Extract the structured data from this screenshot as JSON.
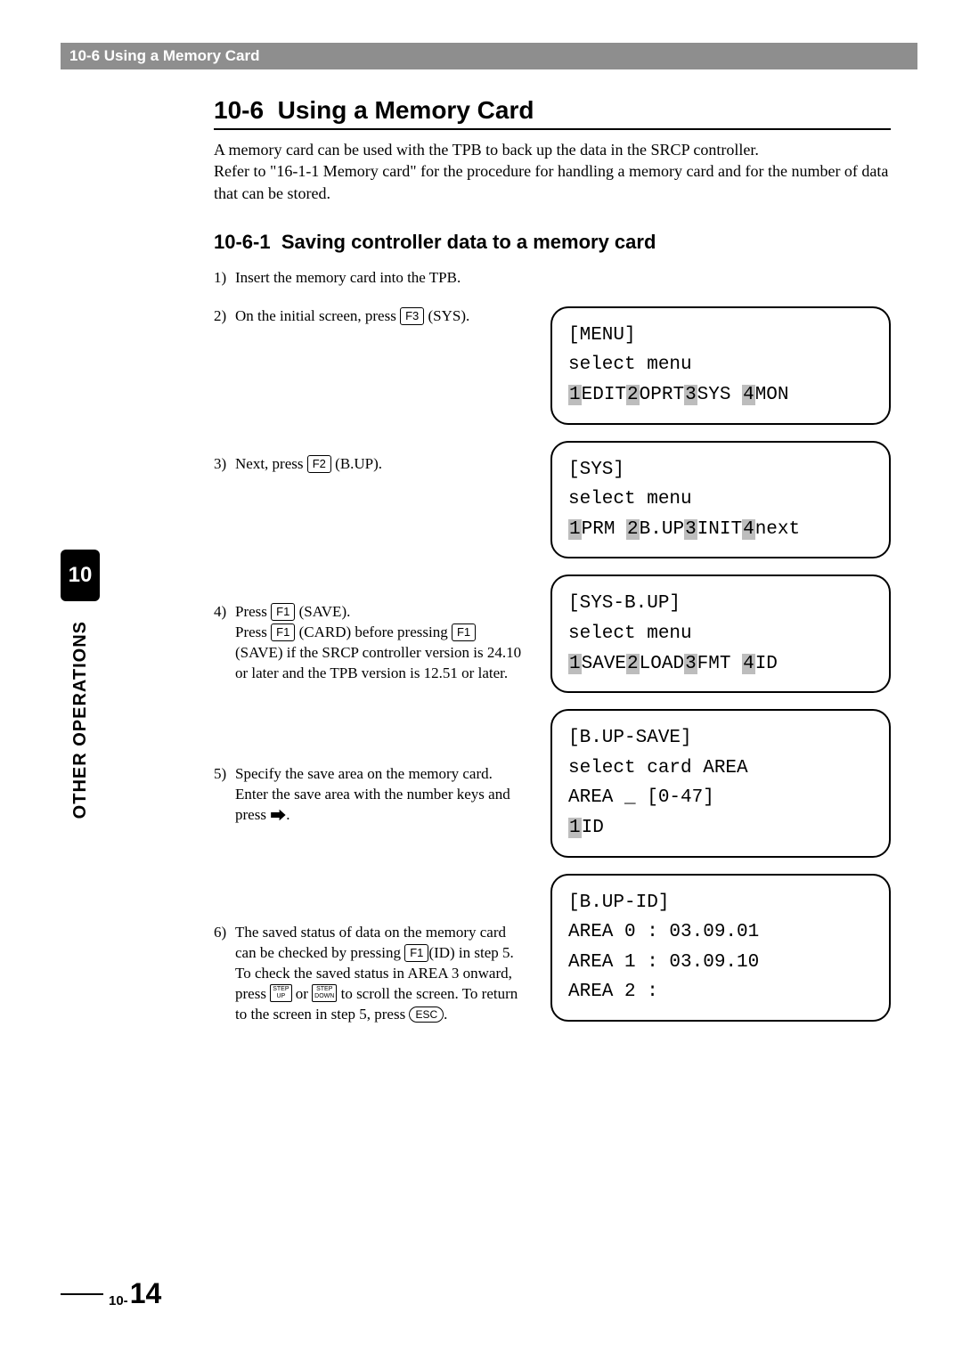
{
  "header": {
    "title": "10-6 Using a Memory Card"
  },
  "section": {
    "number": "10-6",
    "title": "Using a Memory Card"
  },
  "intro": "A memory card can be used with the TPB to back up the data in the SRCP controller.\nRefer to \"16-1-1 Memory card\" for the procedure for handling a memory card and for the number of data that can be stored.",
  "subsection": {
    "number": "10-6-1",
    "title": "Saving controller data to a memory card"
  },
  "steps": [
    {
      "n": "1)",
      "text_a": "Insert the memory card into the TPB."
    },
    {
      "n": "2)",
      "text_a": "On the initial screen, press ",
      "key1": "F3",
      "text_b": " (SYS)."
    },
    {
      "n": "3)",
      "text_a": "Next, press ",
      "key1": "F2",
      "text_b": " (B.UP)."
    },
    {
      "n": "4)",
      "text_a": "Press ",
      "key1": "F1",
      "text_b": " (SAVE).",
      "sub_a": "Press ",
      "key2": "F1",
      "sub_b": " (CARD) before pressing ",
      "key3": "F1",
      "sub_c": " (SAVE) if the SRCP controller version is 24.10 or later and the TPB version is 12.51 or later."
    },
    {
      "n": "5)",
      "text_a": "Specify the save area on the memory card.",
      "sub_a": "Enter the save area with the number keys and press ",
      "arrow": "⮕",
      "sub_b": "."
    },
    {
      "n": "6)",
      "text_a": "The saved status of data on the memory card can be checked by pressing ",
      "key1": "F1",
      "text_b": "(ID) in step 5.",
      "sub_a": "To check the saved status in AREA 3 onward, press ",
      "keysm1_top": "STEP",
      "keysm1_bot": "UP",
      "sub_b": " or ",
      "keysm2_top": "STEP",
      "keysm2_bot": "DOWN",
      "sub_c": " to scroll the screen. To return to the screen in step 5, press ",
      "keyesc": "ESC",
      "sub_d": "."
    }
  ],
  "lcds": [
    {
      "l1": "[MENU]",
      "l2": "select menu",
      "l3": "",
      "fk": [
        {
          "n": "1",
          "t": "EDIT"
        },
        {
          "n": "2",
          "t": "OPRT"
        },
        {
          "n": "3",
          "t": "SYS "
        },
        {
          "n": "4",
          "t": "MON"
        }
      ]
    },
    {
      "l1": "[SYS]",
      "l2": "select menu",
      "l3": "",
      "fk": [
        {
          "n": "1",
          "t": "PRM "
        },
        {
          "n": "2",
          "t": "B.UP"
        },
        {
          "n": "3",
          "t": "INIT"
        },
        {
          "n": "4",
          "t": "next"
        }
      ]
    },
    {
      "l1": "[SYS-B.UP]",
      "l2": "select menu",
      "l3": "",
      "fk": [
        {
          "n": "1",
          "t": "SAVE"
        },
        {
          "n": "2",
          "t": "LOAD"
        },
        {
          "n": "3",
          "t": "FMT "
        },
        {
          "n": "4",
          "t": "ID"
        }
      ]
    },
    {
      "l1": "[B.UP-SAVE]",
      "l2": "select card AREA",
      "l3": "AREA _      [0-47]",
      "fk": [
        {
          "n": "1",
          "t": "ID"
        }
      ]
    },
    {
      "l1": "[B.UP-ID]",
      "l2": "AREA 0 : 03.09.01",
      "l3": "AREA 1 : 03.09.10",
      "l4": "AREA 2 :"
    }
  ],
  "rail": {
    "chapter": "10",
    "label": "OTHER OPERATIONS"
  },
  "footer": {
    "pre": "10-",
    "num": "14"
  }
}
